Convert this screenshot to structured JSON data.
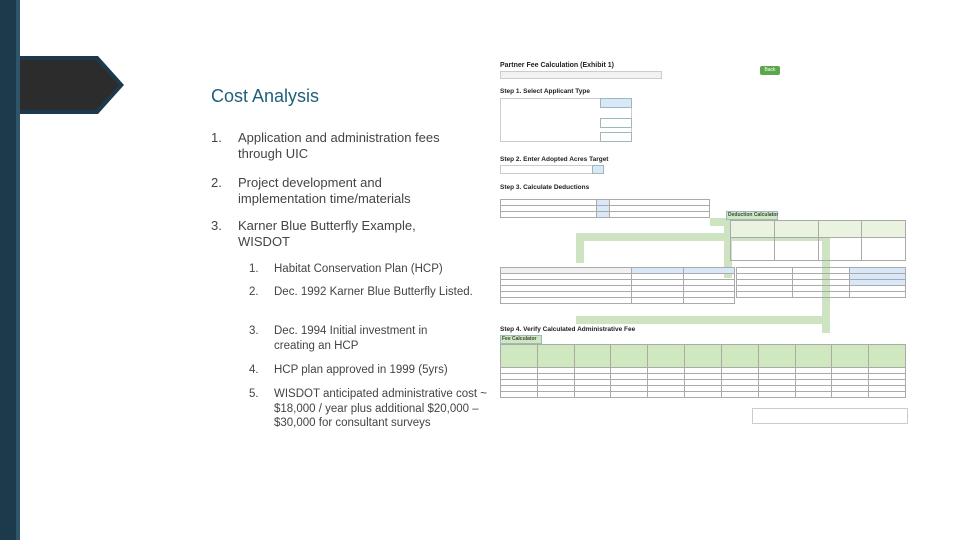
{
  "slide": {
    "title": "Cost Analysis",
    "items": [
      {
        "num": "1.",
        "text": "Application and administration fees through UIC"
      },
      {
        "num": "2.",
        "text": "Project development and implementation time/materials"
      },
      {
        "num": "3.",
        "text": "Karner Blue Butterfly Example, WISDOT"
      }
    ],
    "subitems": [
      {
        "num": "1.",
        "text": "Habitat Conservation Plan (HCP)"
      },
      {
        "num": "2.",
        "text": "Dec. 1992 Karner Blue Butterfly Listed."
      },
      {
        "num": "3.",
        "text": "Dec. 1994 Initial investment in creating an HCP"
      },
      {
        "num": "4.",
        "text": "HCP plan approved in 1999 (5yrs)"
      },
      {
        "num": "5.",
        "text": "WISDOT anticipated administrative cost ~ $18,000 / year plus additional $20,000 – $30,000 for consultant surveys"
      }
    ]
  },
  "sheet": {
    "title": "Partner Fee Calculation (Exhibit 1)",
    "step1": "Step 1. Select Applicant Type",
    "step2": "Step 2. Enter Adopted Acres Target",
    "step3": "Step 3. Calculate Deductions",
    "step4": "Step 4. Verify Calculated Administrative Fee",
    "fee_calc": "Fee Calculator",
    "deduction_calc": "Deduction Calculator",
    "back_label": "Back"
  },
  "colors": {
    "left_bar": "#1d3a4c",
    "title": "#1f5f7a",
    "sheet_green": "#cfe8c0",
    "sheet_blue": "#d8e8f8"
  }
}
